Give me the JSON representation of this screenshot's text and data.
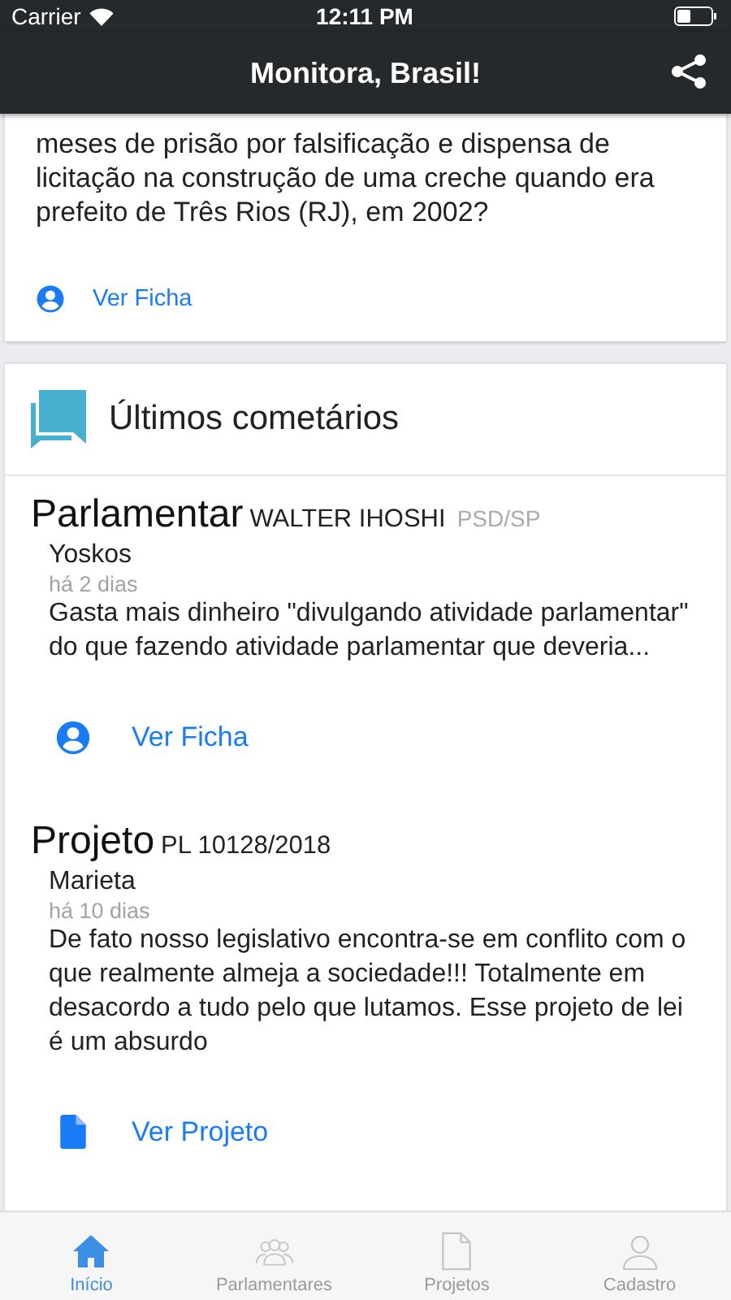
{
  "status_bar": {
    "carrier": "Carrier",
    "time": "12:11 PM"
  },
  "header": {
    "title": "Monitora, Brasil!"
  },
  "top_card": {
    "text": "meses de prisão por falsificação e dispensa de licitação na construção de uma creche quando era prefeito de Três Rios (RJ), em 2002?",
    "action": {
      "label": "Ver Ficha",
      "kind": "person"
    }
  },
  "comments_section": {
    "title": "Últimos cometários",
    "comments": [
      {
        "type": "Parlamentar",
        "subject": "WALTER IHOSHI",
        "party": "PSD/SP",
        "author": "Yoskos",
        "time": "há 2 dias",
        "text": "Gasta mais dinheiro \"divulgando atividade parlamentar\" do que  fazendo atividade parlamentar que deveria...",
        "action": {
          "label": "Ver Ficha",
          "kind": "person"
        }
      },
      {
        "type": "Projeto",
        "subject": "PL 10128/2018",
        "author": "Marieta",
        "time": "há 10 dias",
        "text": "De fato nosso legislativo encontra-se em conflito com o que realmente almeja a sociedade!!! Totalmente em desacordo a tudo pelo que lutamos. Esse projeto de lei é um absurdo",
        "action": {
          "label": "Ver Projeto",
          "kind": "document"
        }
      }
    ]
  },
  "tab_bar": [
    {
      "label": "Início",
      "kind": "home",
      "selected": true
    },
    {
      "label": "Parlamentares",
      "kind": "people",
      "selected": false
    },
    {
      "label": "Projetos",
      "kind": "document",
      "selected": false
    },
    {
      "label": "Cadastro",
      "kind": "person",
      "selected": false
    }
  ]
}
